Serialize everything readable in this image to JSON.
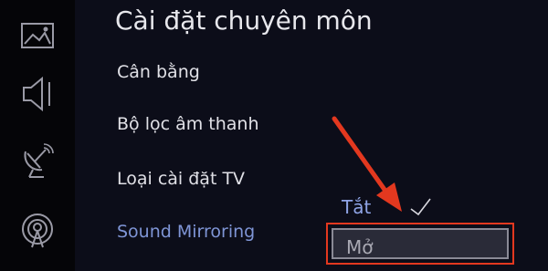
{
  "header": {
    "title": "Cài đặt chuyên môn"
  },
  "sidebar": {
    "items": [
      {
        "icon": "picture-icon"
      },
      {
        "icon": "sound-icon"
      },
      {
        "icon": "broadcast-icon"
      },
      {
        "icon": "antenna-icon"
      }
    ]
  },
  "menu": {
    "items": [
      {
        "label": "Cân bằng"
      },
      {
        "label": "Bộ lọc âm thanh"
      },
      {
        "label": "Loại cài đặt TV"
      },
      {
        "label": "Sound Mirroring"
      }
    ]
  },
  "dropdown": {
    "options": [
      {
        "label": "Tắt",
        "checked": true
      },
      {
        "label": "Mở",
        "checked": false
      }
    ]
  },
  "colors": {
    "background": "#0c0d19",
    "highlight_text": "#7f95d6",
    "annotation": "#e3381f"
  }
}
